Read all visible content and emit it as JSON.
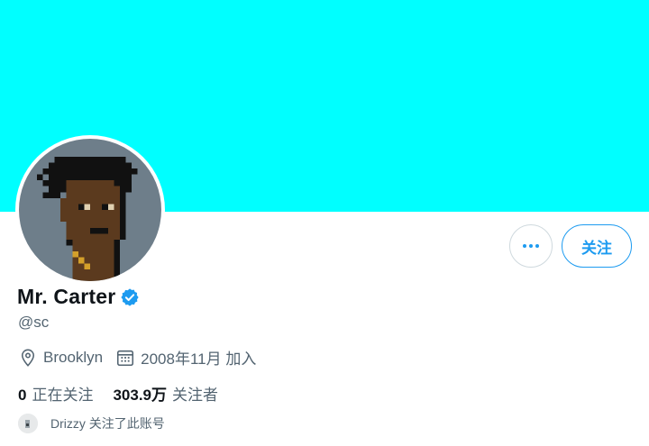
{
  "colors": {
    "banner": "#00ffff",
    "accent": "#1d9bf0",
    "verified": "#1d9bf0",
    "avatar_bg": "#6e7e8a"
  },
  "profile": {
    "display_name": "Mr. Carter",
    "handle": "@sc",
    "location": "Brooklyn",
    "joined": "2008年11月 加入",
    "verified": true
  },
  "actions": {
    "more_label": "···",
    "follow_label": "关注"
  },
  "stats": {
    "following_count": "0",
    "following_label": "正在关注",
    "followers_count": "303.9万",
    "followers_label": "关注者"
  },
  "followed_by": {
    "text": "Drizzy 关注了此账号"
  },
  "icons": {
    "location": "location-pin-icon",
    "calendar": "calendar-icon",
    "verified": "verified-badge-icon",
    "more": "more-dots-icon"
  }
}
